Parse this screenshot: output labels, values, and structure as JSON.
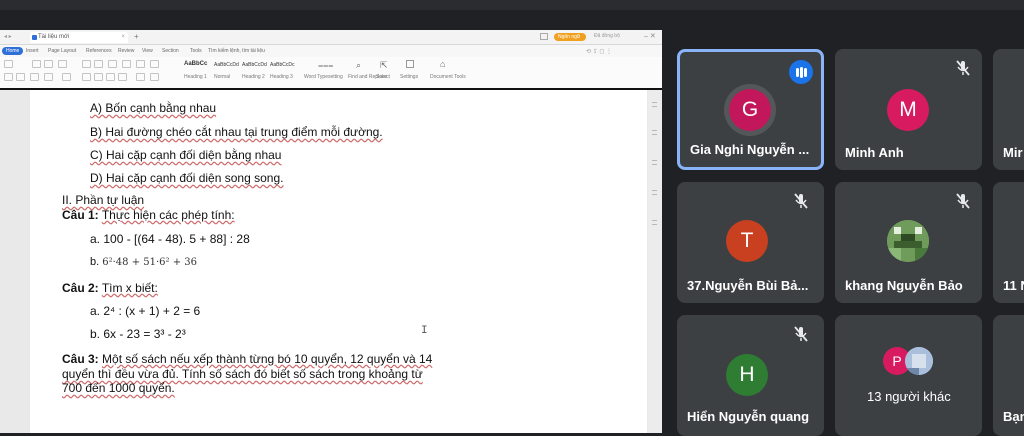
{
  "browser": {
    "tab_title": "Tài liệu mới",
    "new_tab": "+",
    "profile": "Ngôn ngữ",
    "account": "Đã đồng bộ"
  },
  "menu": [
    "Home",
    "Insert",
    "Page Layout",
    "References",
    "Review",
    "View",
    "Section",
    "Tools",
    "Tìm kiếm lệnh, tìm tài liệu"
  ],
  "ribbon": {
    "style_samples": [
      "AaBbCc",
      "AaBbCcDd",
      "AaBbCcDd",
      "AaBbCcDc"
    ],
    "style_names": [
      "Heading 1",
      "Normal",
      "Heading 2",
      "Heading 3"
    ],
    "actions": [
      "Word Typesetting",
      "Find and Replace",
      "Select",
      "Settings",
      "Document Tools"
    ]
  },
  "document": {
    "options": [
      "A) Bốn cạnh bằng nhau",
      "B) Hai đường chéo cắt nhau tại trung điểm mỗi đường.",
      "C) Hai cặp cạnh đối diện bằng nhau",
      "D) Hai cặp cạnh đối diện song song."
    ],
    "section": "II. Phần tự luận",
    "q1_label": "Câu 1:",
    "q1_text": "Thực hiện các phép tính:",
    "q1_a": "a. 100 - [(64 - 48). 5 + 88] : 28",
    "q1_b_label": "b.",
    "q1_b_math": "6²·48 + 51·6² + 36",
    "q2_label": "Câu 2:",
    "q2_text": "Tìm x biết:",
    "q2_a": "a. 2⁴ : (x + 1) + 2 = 6",
    "q2_b": "b. 6x - 23 = 3³ - 2³",
    "q3_label": "Câu 3:",
    "q3_line1": "Một số sách nếu xếp thành từng bó 10 quyển, 12 quyển và 14",
    "q3_line2": "quyển thì đều vừa đủ. Tính số sách đó biết số sách trong khoảng từ",
    "q3_line3": "700 đến 1000 quyển.",
    "cursor": "I"
  },
  "participants": {
    "gia": {
      "name": "Gia Nghi Nguyễn ...",
      "initial": "G",
      "color": "#c2185b"
    },
    "minh": {
      "name": "Minh Anh",
      "initial": "M",
      "color": "#d81b60"
    },
    "mi": {
      "name": "Mir"
    },
    "bui": {
      "name": "37.Nguyễn Bùi Bả...",
      "initial": "T",
      "color": "#c8401f"
    },
    "khang": {
      "name": "khang Nguyễn Bảo"
    },
    "eleven": {
      "name": "11 N"
    },
    "hien": {
      "name": "Hiển Nguyễn quang",
      "initial": "H",
      "color": "#2e7d32"
    },
    "others": {
      "label": "13 người khác",
      "initial": "P",
      "color": "#d81b60"
    },
    "you": {
      "name": "Bạn"
    }
  },
  "colors": {
    "accent": "#1a73e8",
    "active_border": "#8ab4f8",
    "tile": "#3c4043",
    "background": "#202124"
  }
}
